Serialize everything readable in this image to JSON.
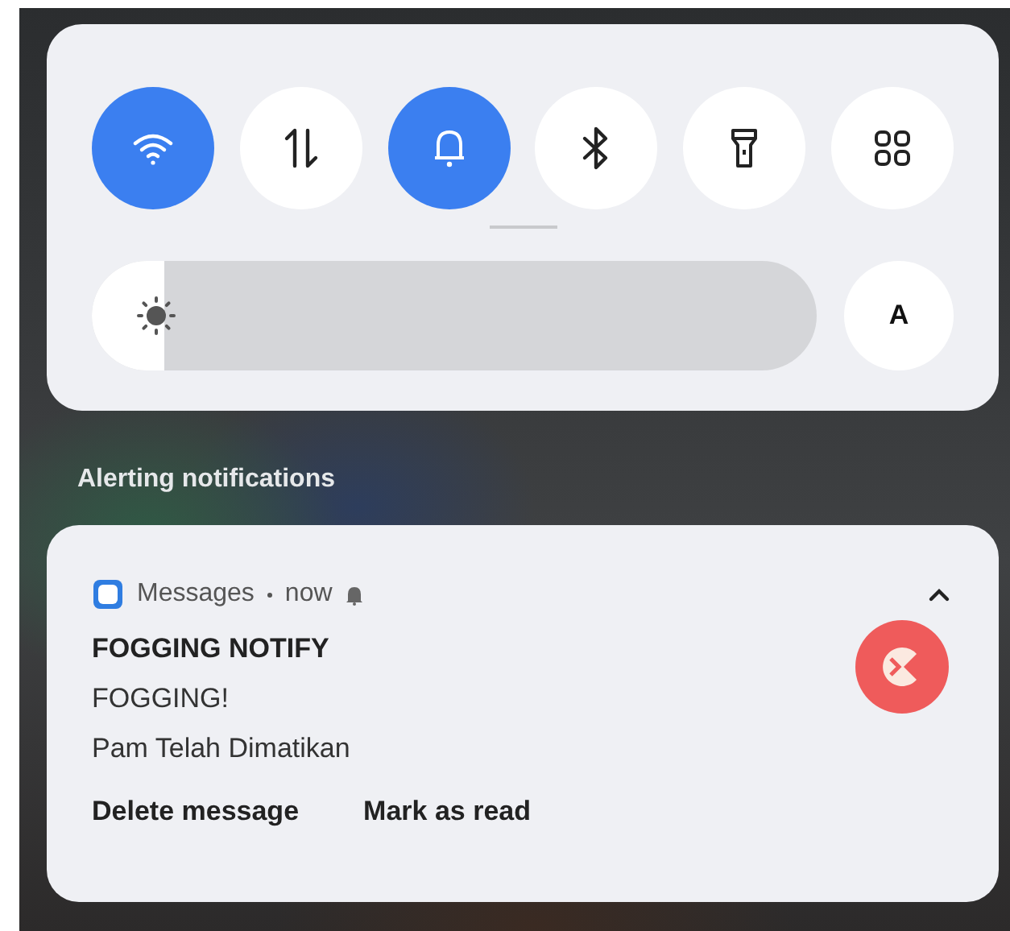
{
  "quick_settings": {
    "tiles": [
      {
        "kind": "wifi",
        "on": true
      },
      {
        "kind": "data",
        "on": false
      },
      {
        "kind": "bell",
        "on": true
      },
      {
        "kind": "bluetooth",
        "on": false
      },
      {
        "kind": "flashlight",
        "on": false
      },
      {
        "kind": "grid",
        "on": false
      }
    ],
    "brightness": {
      "level": 0.1
    },
    "auto_button": "A"
  },
  "section_title": "Alerting notifications",
  "notification": {
    "app": "Messages",
    "time": "now",
    "title": "FOGGING NOTIFY",
    "lines": [
      "FOGGING!",
      "Pam Telah Dimatikan"
    ],
    "actions": [
      "Delete message",
      "Mark as read"
    ]
  }
}
